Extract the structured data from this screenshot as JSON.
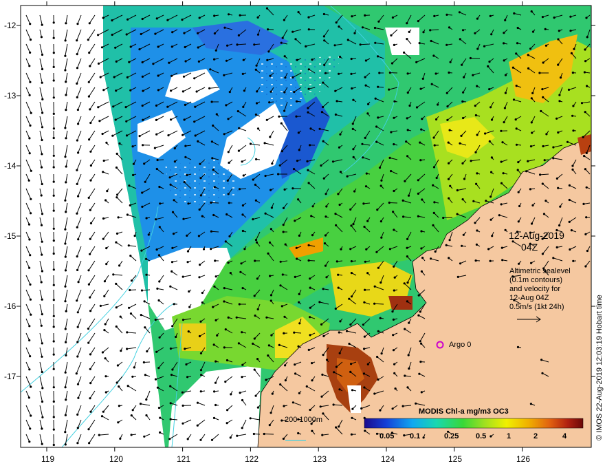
{
  "map": {
    "y_ticks": [
      "-12",
      "-13",
      "-14",
      "-15",
      "-16",
      "-17"
    ],
    "x_ticks": [
      "119",
      "120",
      "121",
      "122",
      "123",
      "124",
      "125",
      "126"
    ],
    "date_line": "12-Aug-2019",
    "time_line": "04Z",
    "info_lines": [
      "Altimetric sealevel",
      "(0.1m contours)",
      "and velocity for",
      "12-Aug 04Z",
      "0.5m/s (1kt 24h)"
    ],
    "argo_label": "Argo 0",
    "bathy_label": "200  1000m",
    "colorbar_title": "MODIS Chl-a mg/m3 OC3",
    "colorbar_ticks": [
      "0.05",
      "0.1",
      "0.25",
      "0.5",
      "1",
      "2",
      "4"
    ],
    "credit": "© IMOS 22-Aug-2019 12:03:19 Hobart time",
    "colors": {
      "land": "#f5c8a0",
      "cloud": "#ffffff",
      "argo_marker": "#cc00cc",
      "contour": "#40d0e0",
      "chl_scale": [
        "#1a0a8c",
        "#1440d8",
        "#10a8f0",
        "#18d8b0",
        "#38d838",
        "#a0e020",
        "#f0f000",
        "#f0b000",
        "#e06010",
        "#b02010",
        "#6a0808"
      ]
    }
  }
}
